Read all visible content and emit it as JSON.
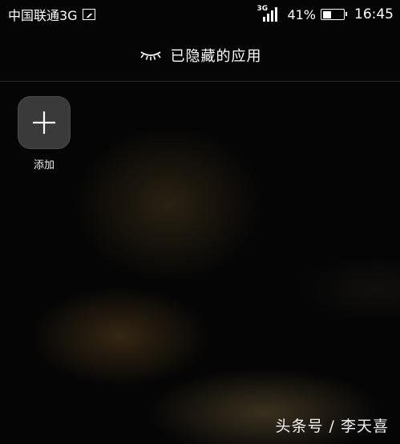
{
  "status_bar": {
    "carrier": "中国联通3G",
    "network_type": "3G",
    "battery_percent_text": "41%",
    "battery_level": 0.41,
    "time": "16:45",
    "icons": [
      "picture-icon",
      "signal-icon",
      "battery-icon"
    ]
  },
  "header": {
    "icon": "eye-closed-icon",
    "title": "已隐藏的应用"
  },
  "apps": [
    {
      "label": "添加",
      "icon": "plus-icon"
    }
  ],
  "watermark": "头条号 / 李天喜",
  "colors": {
    "background": "#000000",
    "tile": "#3a3a3a",
    "text": "#ffffff"
  }
}
